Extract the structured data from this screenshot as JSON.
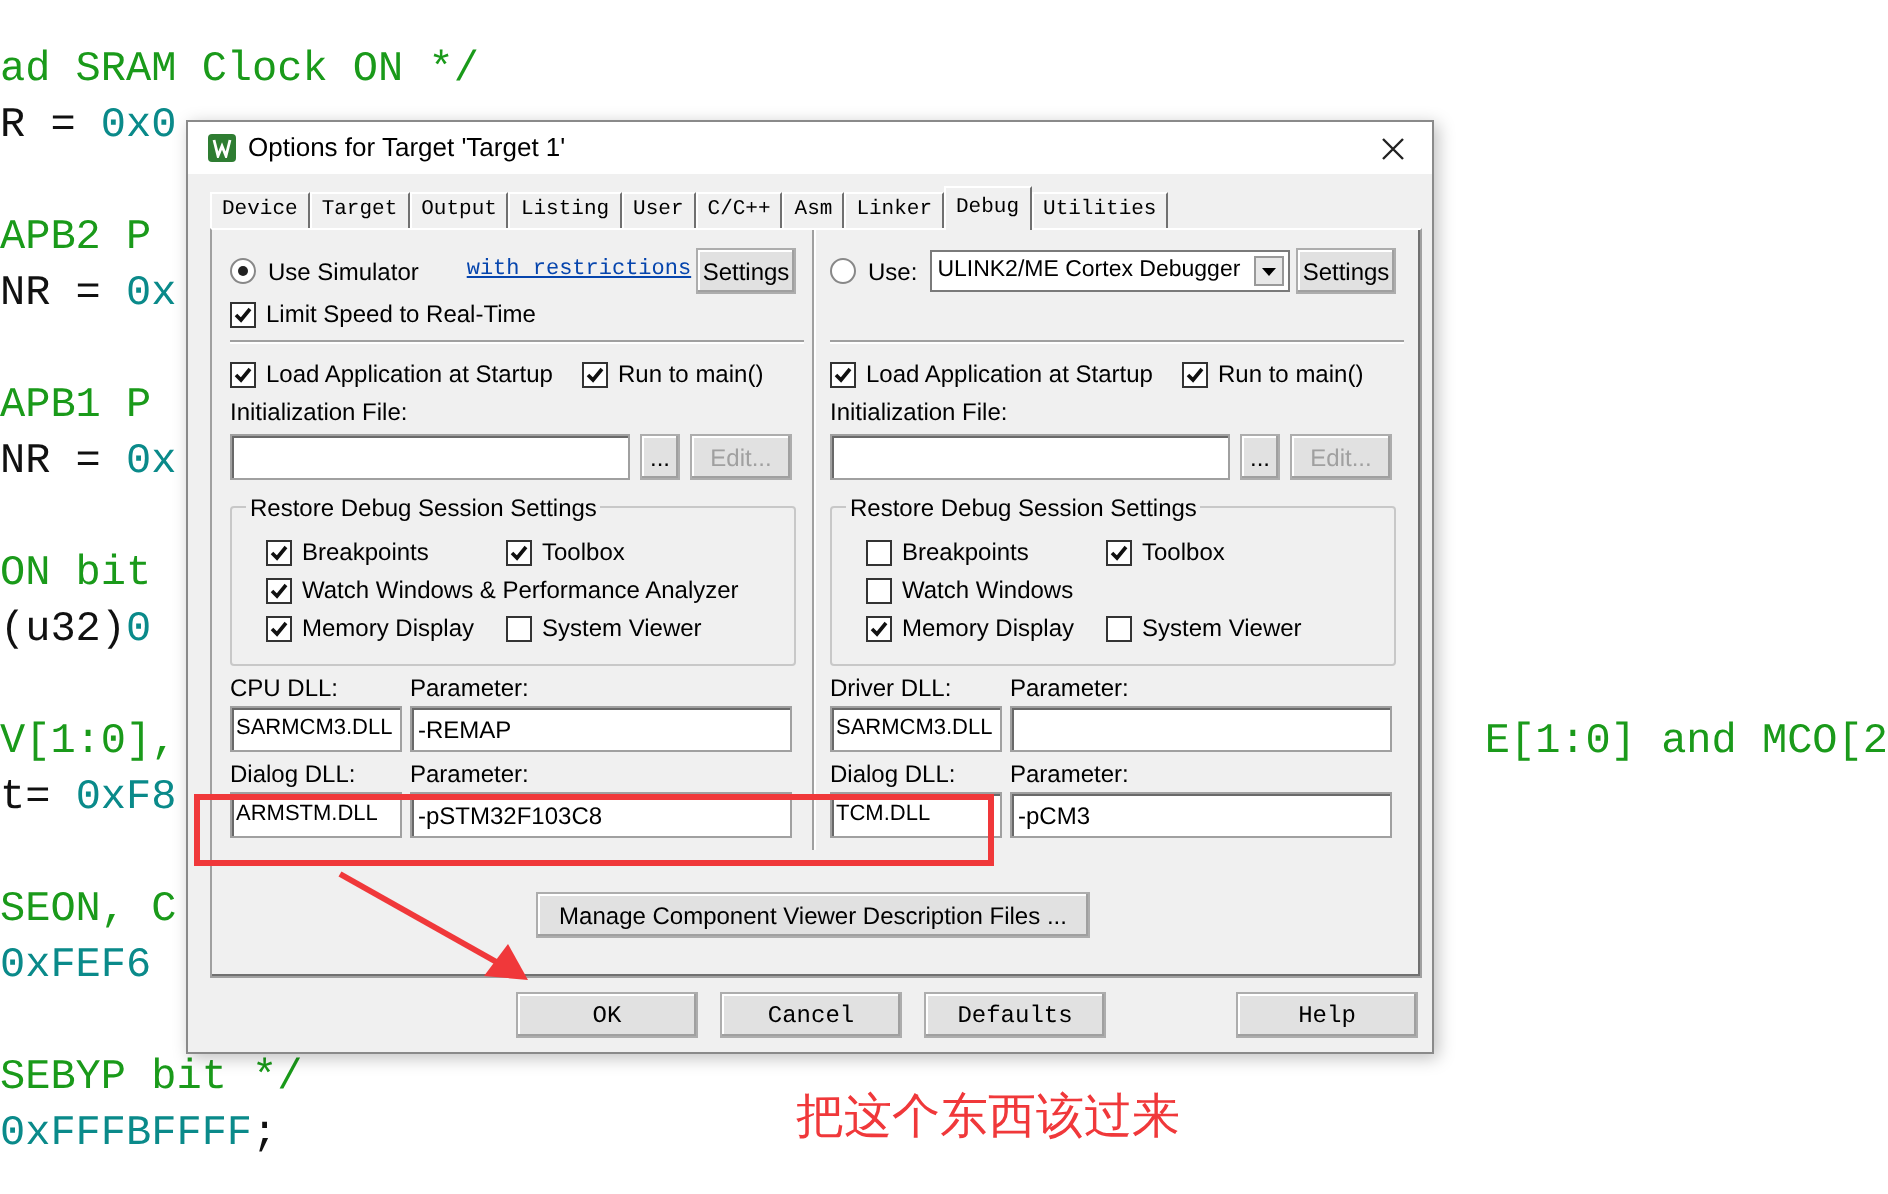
{
  "background_code": {
    "blocks": [
      [
        {
          "parts": [
            {
              "text": "ad SRAM Clock ON */",
              "kind": "comment"
            }
          ]
        },
        {
          "parts": [
            {
              "text": "R = ",
              "kind": "plain"
            },
            {
              "text": "0x0",
              "kind": "number"
            }
          ]
        }
      ],
      [
        {
          "parts": [
            {
              "text": "APB2 P",
              "kind": "comment"
            }
          ]
        },
        {
          "parts": [
            {
              "text": "NR = ",
              "kind": "plain"
            },
            {
              "text": "0x",
              "kind": "number"
            }
          ]
        }
      ],
      [
        {
          "parts": [
            {
              "text": "APB1 P",
              "kind": "comment"
            }
          ]
        },
        {
          "parts": [
            {
              "text": "NR = ",
              "kind": "plain"
            },
            {
              "text": "0x",
              "kind": "number"
            }
          ]
        }
      ],
      [
        {
          "parts": [
            {
              "text": "ON bit",
              "kind": "comment"
            }
          ]
        },
        {
          "parts": [
            {
              "text": "(u32)",
              "kind": "plain"
            },
            {
              "text": "0",
              "kind": "number"
            }
          ]
        }
      ],
      [
        {
          "parts": [
            {
              "text": "V[1:0],",
              "kind": "comment"
            }
          ],
          "right_parts": [
            {
              "text": "E[1:0] and MCO[2",
              "kind": "comment"
            }
          ]
        },
        {
          "parts": [
            {
              "text": "t= ",
              "kind": "plain"
            },
            {
              "text": "0xF8",
              "kind": "number"
            }
          ]
        }
      ],
      [
        {
          "parts": [
            {
              "text": "SEON, C",
              "kind": "comment"
            }
          ]
        },
        {
          "parts": [
            {
              "text": "0xFEF6",
              "kind": "number"
            }
          ]
        }
      ],
      [
        {
          "parts": [
            {
              "text": "SEBYP bit */",
              "kind": "comment"
            }
          ]
        },
        {
          "parts": [
            {
              "text": "0xFFFBFFFF",
              "kind": "number"
            },
            {
              "text": ";",
              "kind": "plain"
            }
          ]
        }
      ]
    ]
  },
  "dialog": {
    "title": "Options for Target 'Target 1'",
    "tabs": [
      {
        "label": "Device",
        "selected": false
      },
      {
        "label": "Target",
        "selected": false
      },
      {
        "label": "Output",
        "selected": false
      },
      {
        "label": "Listing",
        "selected": false
      },
      {
        "label": "User",
        "selected": false
      },
      {
        "label": "C/C++",
        "selected": false
      },
      {
        "label": "Asm",
        "selected": false
      },
      {
        "label": "Linker",
        "selected": false
      },
      {
        "label": "Debug",
        "selected": true
      },
      {
        "label": "Utilities",
        "selected": false
      }
    ],
    "columns": [
      {
        "source": {
          "kind": "simulator",
          "label": "Use Simulator",
          "selected": true,
          "link": "with restrictions",
          "button": "Settings"
        },
        "limit_speed": {
          "label": "Limit Speed to Real-Time",
          "checked": true
        },
        "load_app": {
          "label": "Load Application at Startup",
          "checked": true
        },
        "run_to_main": {
          "label": "Run to main()",
          "checked": true
        },
        "init_file": {
          "label": "Initialization File:",
          "browse": "...",
          "edit": "Edit...",
          "edit_disabled": true
        },
        "restore": {
          "title": "Restore Debug Session Settings",
          "rows": [
            [
              {
                "label": "Breakpoints",
                "checked": true
              },
              {
                "label": "Toolbox",
                "checked": true
              }
            ],
            [
              {
                "label": "Watch Windows & Performance Analyzer",
                "checked": true
              }
            ],
            [
              {
                "label": "Memory Display",
                "checked": true
              },
              {
                "label": "System Viewer",
                "checked": false
              }
            ]
          ]
        },
        "dlls": [
          {
            "label": "CPU DLL:",
            "value": "SARMCM3.DLL",
            "param_label": "Parameter:",
            "param_value": "-REMAP"
          },
          {
            "label": "Dialog DLL:",
            "value": "ARMSTM.DLL",
            "param_label": "Parameter:",
            "param_value": "-pSTM32F103C8"
          }
        ]
      },
      {
        "source": {
          "kind": "target",
          "label": "Use:",
          "selected": false,
          "dropdown": "ULINK2/ME Cortex Debugger",
          "button": "Settings"
        },
        "load_app": {
          "label": "Load Application at Startup",
          "checked": true
        },
        "run_to_main": {
          "label": "Run to main()",
          "checked": true
        },
        "init_file": {
          "label": "Initialization File:",
          "browse": "...",
          "edit": "Edit...",
          "edit_disabled": true
        },
        "restore": {
          "title": "Restore Debug Session Settings",
          "rows": [
            [
              {
                "label": "Breakpoints",
                "checked": false
              },
              {
                "label": "Toolbox",
                "checked": true
              }
            ],
            [
              {
                "label": "Watch Windows",
                "checked": false
              }
            ],
            [
              {
                "label": "Memory Display",
                "checked": true
              },
              {
                "label": "System Viewer",
                "checked": false
              }
            ]
          ]
        },
        "dlls": [
          {
            "label": "Driver DLL:",
            "value": "SARMCM3.DLL",
            "param_label": "Parameter:"
          },
          {
            "label": "Dialog DLL:",
            "value": "TCM.DLL",
            "param_label": "Parameter:",
            "param_value": "-pCM3"
          }
        ]
      }
    ],
    "manage_button": "Manage Component Viewer Description Files ...",
    "buttons": [
      {
        "label": "OK"
      },
      {
        "label": "Cancel"
      },
      {
        "label": "Defaults"
      },
      {
        "label": "Help",
        "kind": "help"
      }
    ]
  },
  "annotation": {
    "text": "把这个东西该过来"
  }
}
